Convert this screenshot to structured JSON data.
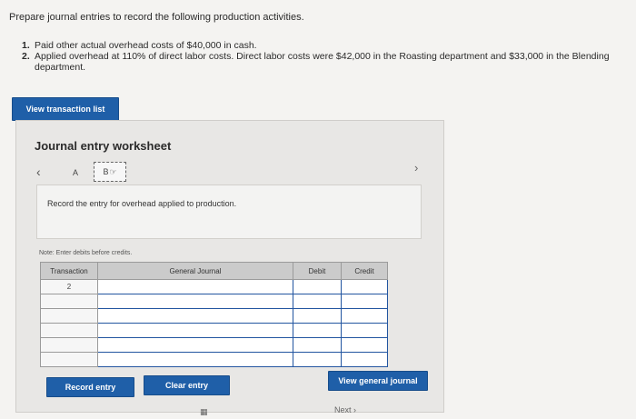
{
  "intro": "Prepare journal entries to record the following production activities.",
  "steps": [
    {
      "num": "1.",
      "text": "Paid other actual overhead costs of $40,000 in cash."
    },
    {
      "num": "2.",
      "text": "Applied overhead at 110% of direct labor costs. Direct labor costs were $42,000 in the Roasting department and $33,000 in the Blending department."
    }
  ],
  "buttons": {
    "view_transaction_list": "View transaction list",
    "record_entry": "Record entry",
    "clear_entry": "Clear entry",
    "view_general_journal": "View general journal",
    "next": "Next"
  },
  "worksheet": {
    "title": "Journal entry worksheet",
    "tabs": [
      "A",
      "B"
    ],
    "entry_prompt": "Record the entry for overhead applied to production.",
    "note": "Note: Enter debits before credits.",
    "columns": [
      "Transaction",
      "General Journal",
      "Debit",
      "Credit"
    ],
    "transaction_number": "2"
  }
}
